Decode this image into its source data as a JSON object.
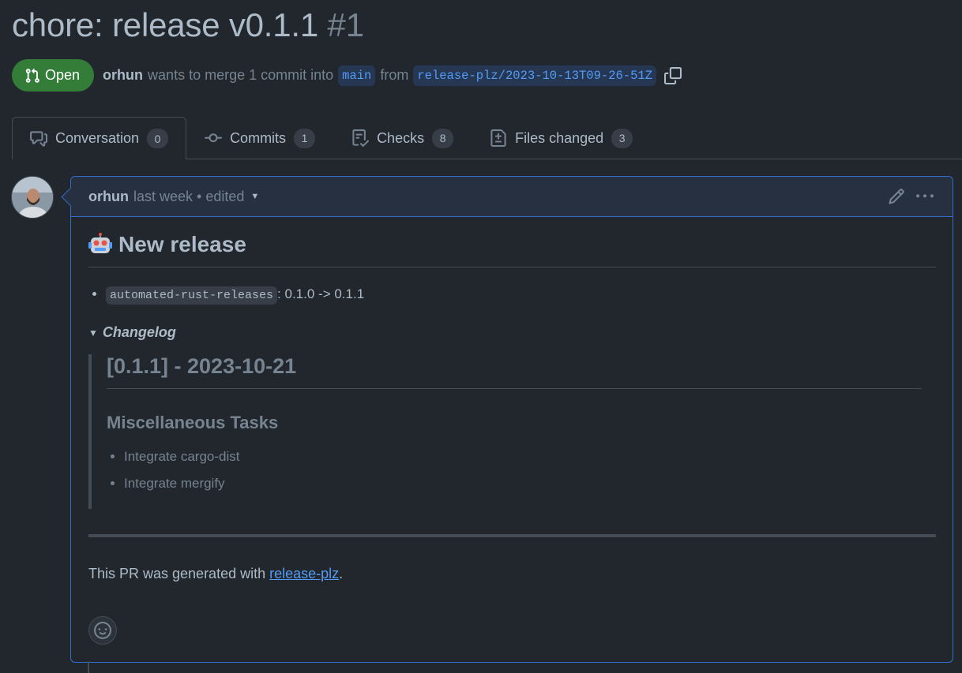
{
  "pr": {
    "title": "chore: release v0.1.1",
    "number": "#1",
    "state": "Open",
    "author": "orhun",
    "merge_text": "wants to merge 1 commit into",
    "base_branch": "main",
    "from_text": "from",
    "head_branch": "release-plz/2023-10-13T09-26-51Z"
  },
  "tabs": [
    {
      "label": "Conversation",
      "count": "0",
      "icon": "comment-discussion-icon"
    },
    {
      "label": "Commits",
      "count": "1",
      "icon": "git-commit-icon"
    },
    {
      "label": "Checks",
      "count": "8",
      "icon": "checklist-icon"
    },
    {
      "label": "Files changed",
      "count": "3",
      "icon": "file-diff-icon"
    }
  ],
  "comment": {
    "author": "orhun",
    "time": "last week",
    "edited": "• edited",
    "heading": "New release",
    "package_name": "automated-rust-releases",
    "package_change": ": 0.1.0 -> 0.1.1",
    "summary": "Changelog",
    "release_heading": "[0.1.1] - 2023-10-21",
    "section_heading": "Miscellaneous Tasks",
    "tasks": [
      "Integrate cargo-dist",
      "Integrate mergify"
    ],
    "footer_prefix": "This PR was generated with ",
    "footer_link": "release-plz",
    "footer_suffix": "."
  },
  "colors": {
    "background": "#22272e",
    "open_badge": "#347d39",
    "link": "#539bf5",
    "comment_border": "#316dca"
  }
}
